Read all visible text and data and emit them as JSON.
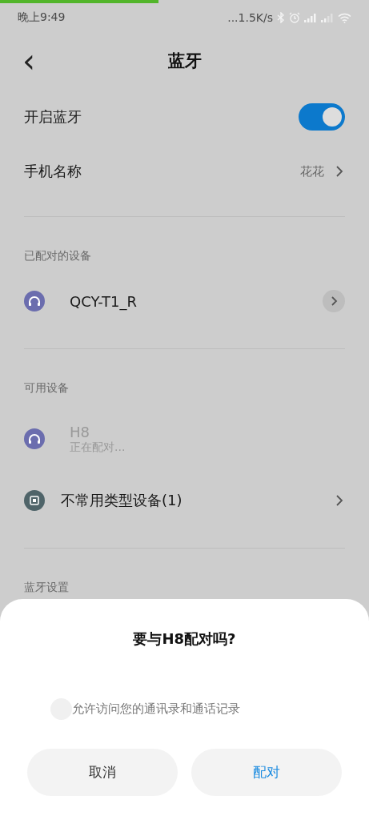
{
  "status_bar": {
    "time": "晚上9:49",
    "network_speed": "...1.5K/s"
  },
  "header": {
    "back": "‹",
    "title": "蓝牙"
  },
  "settings": [
    {
      "kind": "toggle",
      "label": "开启蓝牙",
      "on": true
    },
    {
      "kind": "link",
      "label": "手机名称",
      "value": "花花"
    }
  ],
  "sections": [
    {
      "title": "已配对的设备",
      "devices": [
        {
          "kind": "headset",
          "name": "QCY-T1_R",
          "pairing": false
        }
      ]
    },
    {
      "title": "可用设备",
      "devices": [
        {
          "kind": "headset",
          "name": "H8",
          "status": "正在配对...",
          "pairing": true
        },
        {
          "kind": "other",
          "name": "不常用类型设备(1)",
          "pairing": false
        }
      ]
    },
    {
      "title": "蓝牙设置"
    }
  ],
  "dialog": {
    "title": "要与H8配对吗?",
    "checkbox": {
      "label": "允许访问您的通讯录和通话记录",
      "checked": false
    },
    "buttons": [
      {
        "label": "取消",
        "primary": false
      },
      {
        "label": "配对",
        "primary": true
      }
    ]
  }
}
